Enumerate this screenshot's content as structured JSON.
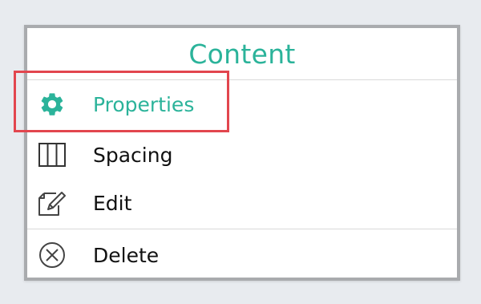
{
  "colors": {
    "accent": "#2bb39a",
    "highlight": "#e2464e",
    "frame": "#a9abae"
  },
  "menu": {
    "title": "Content",
    "items": [
      {
        "label": "Properties",
        "icon": "gear-icon",
        "active": true
      },
      {
        "label": "Spacing",
        "icon": "columns-icon",
        "active": false
      },
      {
        "label": "Edit",
        "icon": "edit-icon",
        "active": false
      },
      {
        "label": "Delete",
        "icon": "delete-circle-x-icon",
        "active": false
      }
    ]
  }
}
